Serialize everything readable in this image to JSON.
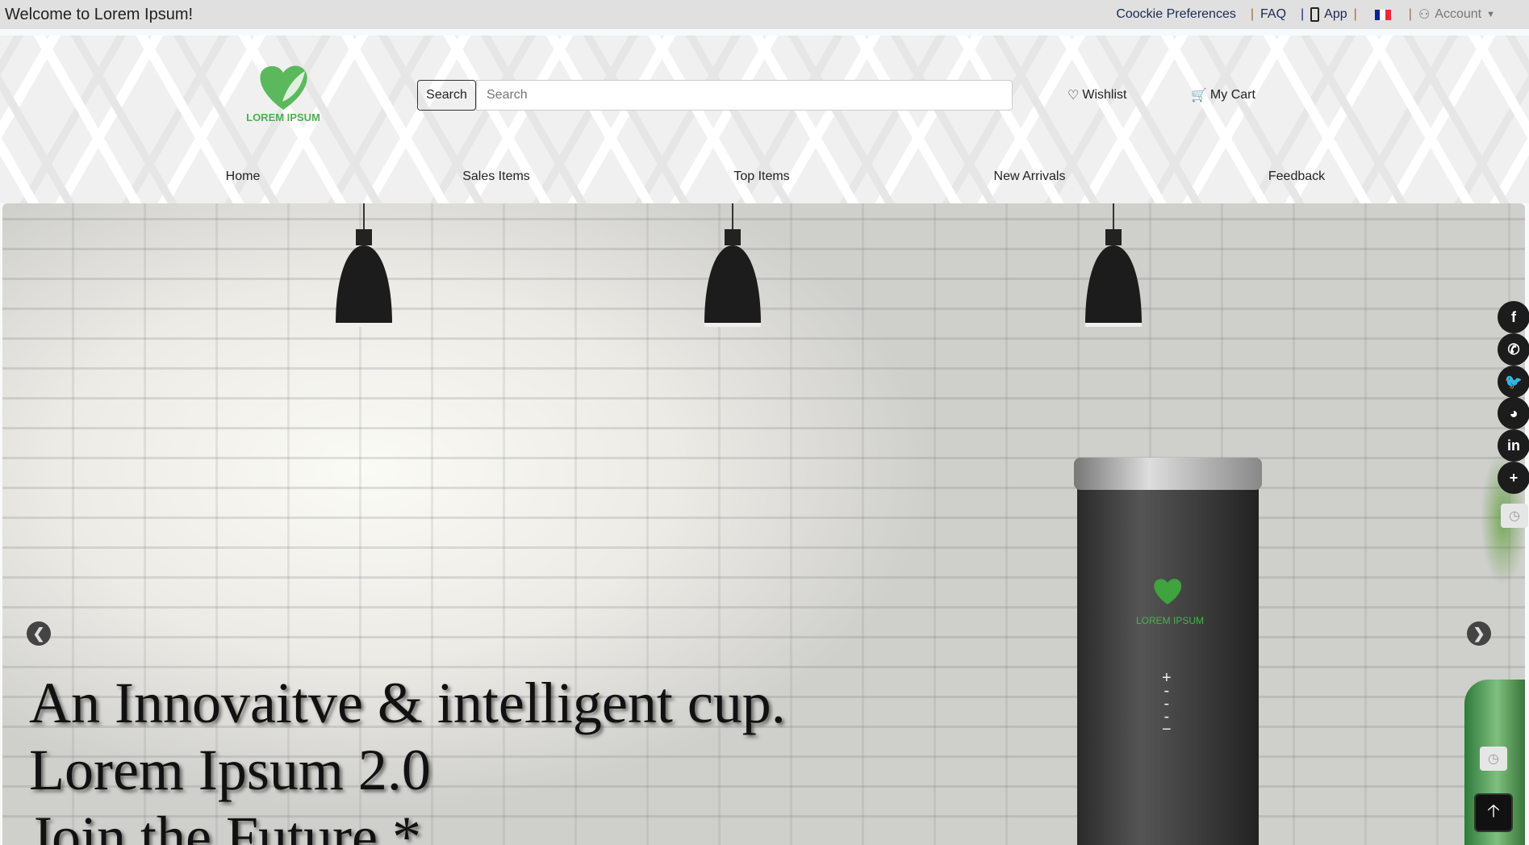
{
  "topbar": {
    "welcome": "Welcome to Lorem Ipsum!",
    "cookie": "Coockie Preferences",
    "faq": "FAQ",
    "app": "App",
    "account": "Account",
    "sep": "|"
  },
  "header": {
    "logo_text": "LOREM IPSUM",
    "search_button": "Search",
    "search_placeholder": "Search",
    "wishlist": "Wishlist",
    "cart": "My Cart"
  },
  "nav": [
    "Home",
    "Sales Items",
    "Top Items",
    "New Arrivals",
    "Feedback"
  ],
  "hero": {
    "lines": [
      "An Innovaitve & intelligent cup.",
      "Lorem Ipsum 2.0",
      "Join the Future *"
    ],
    "cup_logo": "LOREM IPSUM"
  },
  "social": [
    {
      "icon": "facebook-icon",
      "glyph": "f"
    },
    {
      "icon": "whatsapp-icon",
      "glyph": "✆"
    },
    {
      "icon": "twitter-icon",
      "glyph": "🐦"
    },
    {
      "icon": "reddit-icon",
      "glyph": "◕"
    },
    {
      "icon": "linkedin-icon",
      "glyph": "in"
    },
    {
      "icon": "plus-icon",
      "glyph": "+"
    }
  ],
  "colors": {
    "brand_green": "#4caf50",
    "topbar": "#e0e0e0"
  }
}
